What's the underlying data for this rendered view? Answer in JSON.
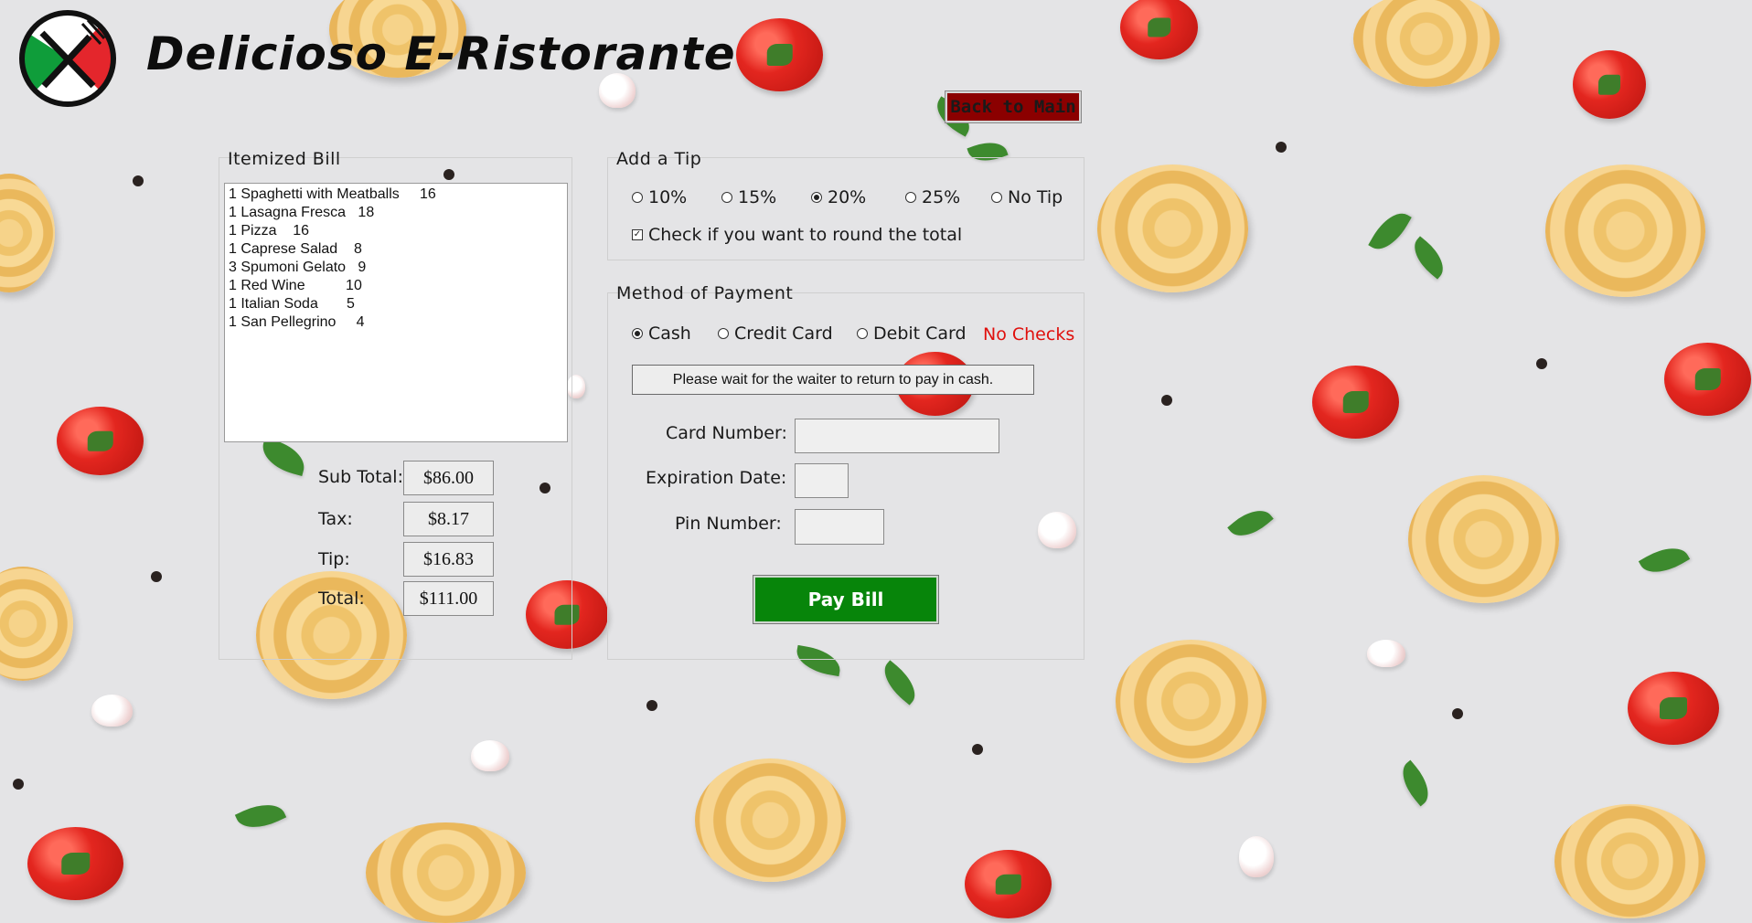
{
  "app": {
    "title": "Delicioso  E-Ristorante"
  },
  "nav": {
    "back_label": "Back to Main"
  },
  "bill": {
    "title": "Itemized Bill",
    "items": [
      "1 Spaghetti with Meatballs     16",
      "1 Lasagna Fresca   18",
      "1 Pizza    16",
      "1 Caprese Salad    8",
      "3 Spumoni Gelato   9",
      "1 Red Wine          10",
      "1 Italian Soda       5",
      "1 San Pellegrino     4"
    ],
    "subtotal_label": "Sub Total:",
    "subtotal": "$86.00",
    "tax_label": "Tax:",
    "tax": "$8.17",
    "tip_label": "Tip:",
    "tip": "$16.83",
    "total_label": "Total:",
    "total": "$111.00"
  },
  "tip": {
    "title": "Add a Tip",
    "options": [
      "10%",
      "15%",
      "20%",
      "25%",
      "No Tip"
    ],
    "selected": "20%",
    "round_label": "Check if you want to round the total",
    "round_checked": true
  },
  "payment": {
    "title": "Method of Payment",
    "options": [
      "Cash",
      "Credit Card",
      "Debit Card"
    ],
    "selected": "Cash",
    "no_checks": "No Checks",
    "message": "Please wait for the waiter to return to pay in cash.",
    "card_number_label": "Card Number:",
    "card_number_value": "",
    "expiration_label": "Expiration Date:",
    "expiration_value": "",
    "pin_label": "Pin Number:",
    "pin_value": "",
    "pay_label": "Pay Bill"
  },
  "colors": {
    "back_button": "#8b0000",
    "pay_button": "#07850a",
    "no_checks": "#e0100d",
    "logo_green": "#0f9d3a",
    "logo_red": "#e4262c"
  }
}
